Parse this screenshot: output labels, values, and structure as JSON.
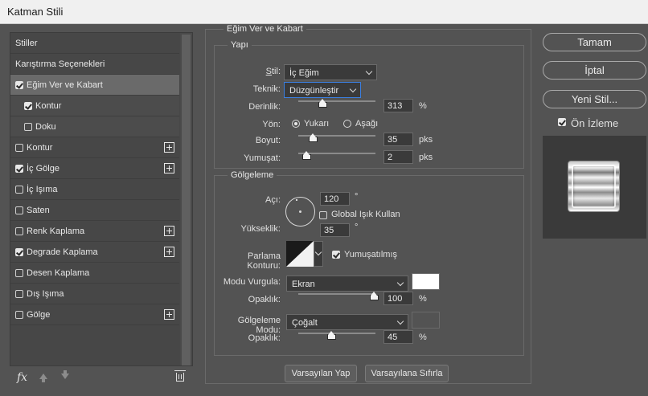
{
  "window": {
    "title": "Katman Stili"
  },
  "left_panel": {
    "items": [
      {
        "label": "Stiller",
        "checkbox": false,
        "checked": false,
        "plus": false,
        "selected": false,
        "sub": false
      },
      {
        "label": "Karıştırma Seçenekleri",
        "checkbox": false,
        "checked": false,
        "plus": false,
        "selected": false,
        "sub": false
      },
      {
        "label": "Eğim Ver ve Kabart",
        "checkbox": true,
        "checked": true,
        "plus": false,
        "selected": true,
        "sub": false
      },
      {
        "label": "Kontur",
        "checkbox": true,
        "checked": true,
        "plus": false,
        "selected": false,
        "sub": true
      },
      {
        "label": "Doku",
        "checkbox": true,
        "checked": false,
        "plus": false,
        "selected": false,
        "sub": true
      },
      {
        "label": "Kontur",
        "checkbox": true,
        "checked": false,
        "plus": true,
        "selected": false,
        "sub": false
      },
      {
        "label": "İç Gölge",
        "checkbox": true,
        "checked": true,
        "plus": true,
        "selected": false,
        "sub": false
      },
      {
        "label": "İç Işıma",
        "checkbox": true,
        "checked": false,
        "plus": false,
        "selected": false,
        "sub": false
      },
      {
        "label": "Saten",
        "checkbox": true,
        "checked": false,
        "plus": false,
        "selected": false,
        "sub": false
      },
      {
        "label": "Renk Kaplama",
        "checkbox": true,
        "checked": false,
        "plus": true,
        "selected": false,
        "sub": false
      },
      {
        "label": "Degrade Kaplama",
        "checkbox": true,
        "checked": true,
        "plus": true,
        "selected": false,
        "sub": false
      },
      {
        "label": "Desen Kaplama",
        "checkbox": true,
        "checked": false,
        "plus": false,
        "selected": false,
        "sub": false
      },
      {
        "label": "Dış Işıma",
        "checkbox": true,
        "checked": false,
        "plus": false,
        "selected": false,
        "sub": false
      },
      {
        "label": "Gölge",
        "checkbox": true,
        "checked": false,
        "plus": true,
        "selected": false,
        "sub": false
      }
    ],
    "icons": {
      "fx": "fx",
      "move_up": "arrow-up-icon",
      "move_down": "arrow-down-icon",
      "delete": "trash-icon"
    }
  },
  "bevel": {
    "title": "Eğim Ver ve Kabart",
    "structure": {
      "title": "Yapı",
      "style_label": "Stil:",
      "style_value": "İç Eğim",
      "technique_label": "Teknik:",
      "technique_value": "Düzgünleştir",
      "depth_label": "Derinlik:",
      "depth_value": "313",
      "depth_unit": "%",
      "direction_label": "Yön:",
      "direction_up": "Yukarı",
      "direction_down": "Aşağı",
      "direction_selected": "up",
      "size_label": "Boyut:",
      "size_value": "35",
      "size_unit": "pks",
      "soften_label": "Yumuşat:",
      "soften_value": "2",
      "soften_unit": "pks"
    },
    "shading": {
      "title": "Gölgeleme",
      "angle_label": "Açı:",
      "angle_value": "120",
      "degree": "°",
      "global_light_label": "Global Işık Kullan",
      "global_light_checked": false,
      "altitude_label": "Yükseklik:",
      "altitude_value": "35",
      "gloss_label": "Parlama Konturu:",
      "anti_aliased_label": "Yumuşatılmış",
      "anti_aliased_checked": true,
      "highlight_mode_label": "Modu Vurgula:",
      "highlight_mode_value": "Ekran",
      "highlight_color": "#ffffff",
      "highlight_opacity_label": "Opaklık:",
      "highlight_opacity_value": "100",
      "shadow_mode_label": "Gölgeleme Modu:",
      "shadow_mode_value": "Çoğalt",
      "shadow_color": "#535353",
      "shadow_opacity_label": "Opaklık:",
      "shadow_opacity_value": "45",
      "percent": "%"
    },
    "buttons": {
      "make_default": "Varsayılan Yap",
      "reset_default": "Varsayılana Sıfırla"
    }
  },
  "sliders": {
    "depth": 0.31,
    "size": 0.14,
    "soften": 0.02,
    "highlight_opacity": 1.0,
    "shadow_opacity": 0.45
  },
  "right": {
    "ok": "Tamam",
    "cancel": "İptal",
    "new_style": "Yeni Stil...",
    "preview_label": "Ön İzleme",
    "preview_checked": true
  }
}
